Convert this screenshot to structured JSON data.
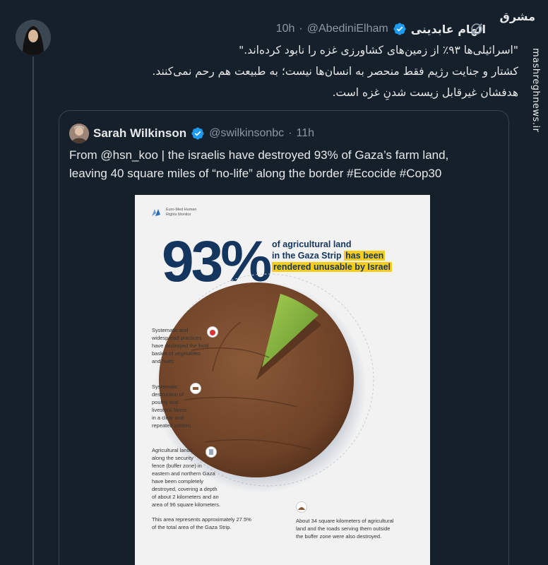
{
  "watermark": {
    "logo": "مشرق",
    "url": "mashreghnews.ir"
  },
  "tweet": {
    "author_name": "الهام عابدینی",
    "handle": "@AbediniElham",
    "dot": "·",
    "time": "10h",
    "lines": [
      "\"اسرائیلی‌ها ۹۳٪ از زمین‌های کشاورزی غزه را نابود کرده‌اند.\"",
      "کشتار و جنایت رژیم فقط منحصر به انسان‌ها نیست؛ به طبیعت هم رحم نمی‌کنند.",
      "هدفشان غیرقابل زیست شدنِ غزه است."
    ]
  },
  "quote": {
    "author_name": "Sarah Wilkinson",
    "handle": "@swilkinsonbc",
    "dot": "·",
    "time": "11h",
    "lines": [
      "From @hsn_koo | the israelis have destroyed 93% of Gaza’s farm land,",
      "leaving 40 square miles of “no-life” along the border #Ecocide #Cop30"
    ]
  },
  "infographic": {
    "org_line1": "Euro-Med Human",
    "org_line2": "Rights Monitor",
    "big_number": "93%",
    "headline_line1": "of agricultural land",
    "headline_line2_plain": "in the Gaza Strip ",
    "headline_line2_hl": "has been",
    "headline_line3_hl": "rendered unusable by Israel",
    "fact1": [
      "Systematic and",
      "widespread practices",
      "have destroyed the food",
      "basket of vegetables",
      "and fruits"
    ],
    "fact2": [
      "Systematic",
      "destruction of",
      "poultry and",
      "livestock farms",
      "in a clear and",
      "repeated pattern"
    ],
    "fact3": [
      "Agricultural lands",
      "along the security",
      "fence (buffer zone) in",
      "eastern and northern Gaza",
      "have been completely",
      "destroyed, covering a depth",
      "of about 2 kilometers and an",
      "area of 96 square kilometers."
    ],
    "fact4": [
      "This area represents approximately 27.5%",
      "of the total area of the Gaza Strip."
    ],
    "fact5": [
      "About 34 square kilometers of agricultural",
      "land and the roads serving them outside",
      "the buffer zone were also destroyed."
    ],
    "chart_share_destroyed": 0.93
  },
  "colors": {
    "background": "#15202b",
    "verified": "#1d9bf0",
    "highlight": "#f7cc1b",
    "navy": "#14365e",
    "soil": "#7a4a2c",
    "grass": "#86b83a"
  }
}
